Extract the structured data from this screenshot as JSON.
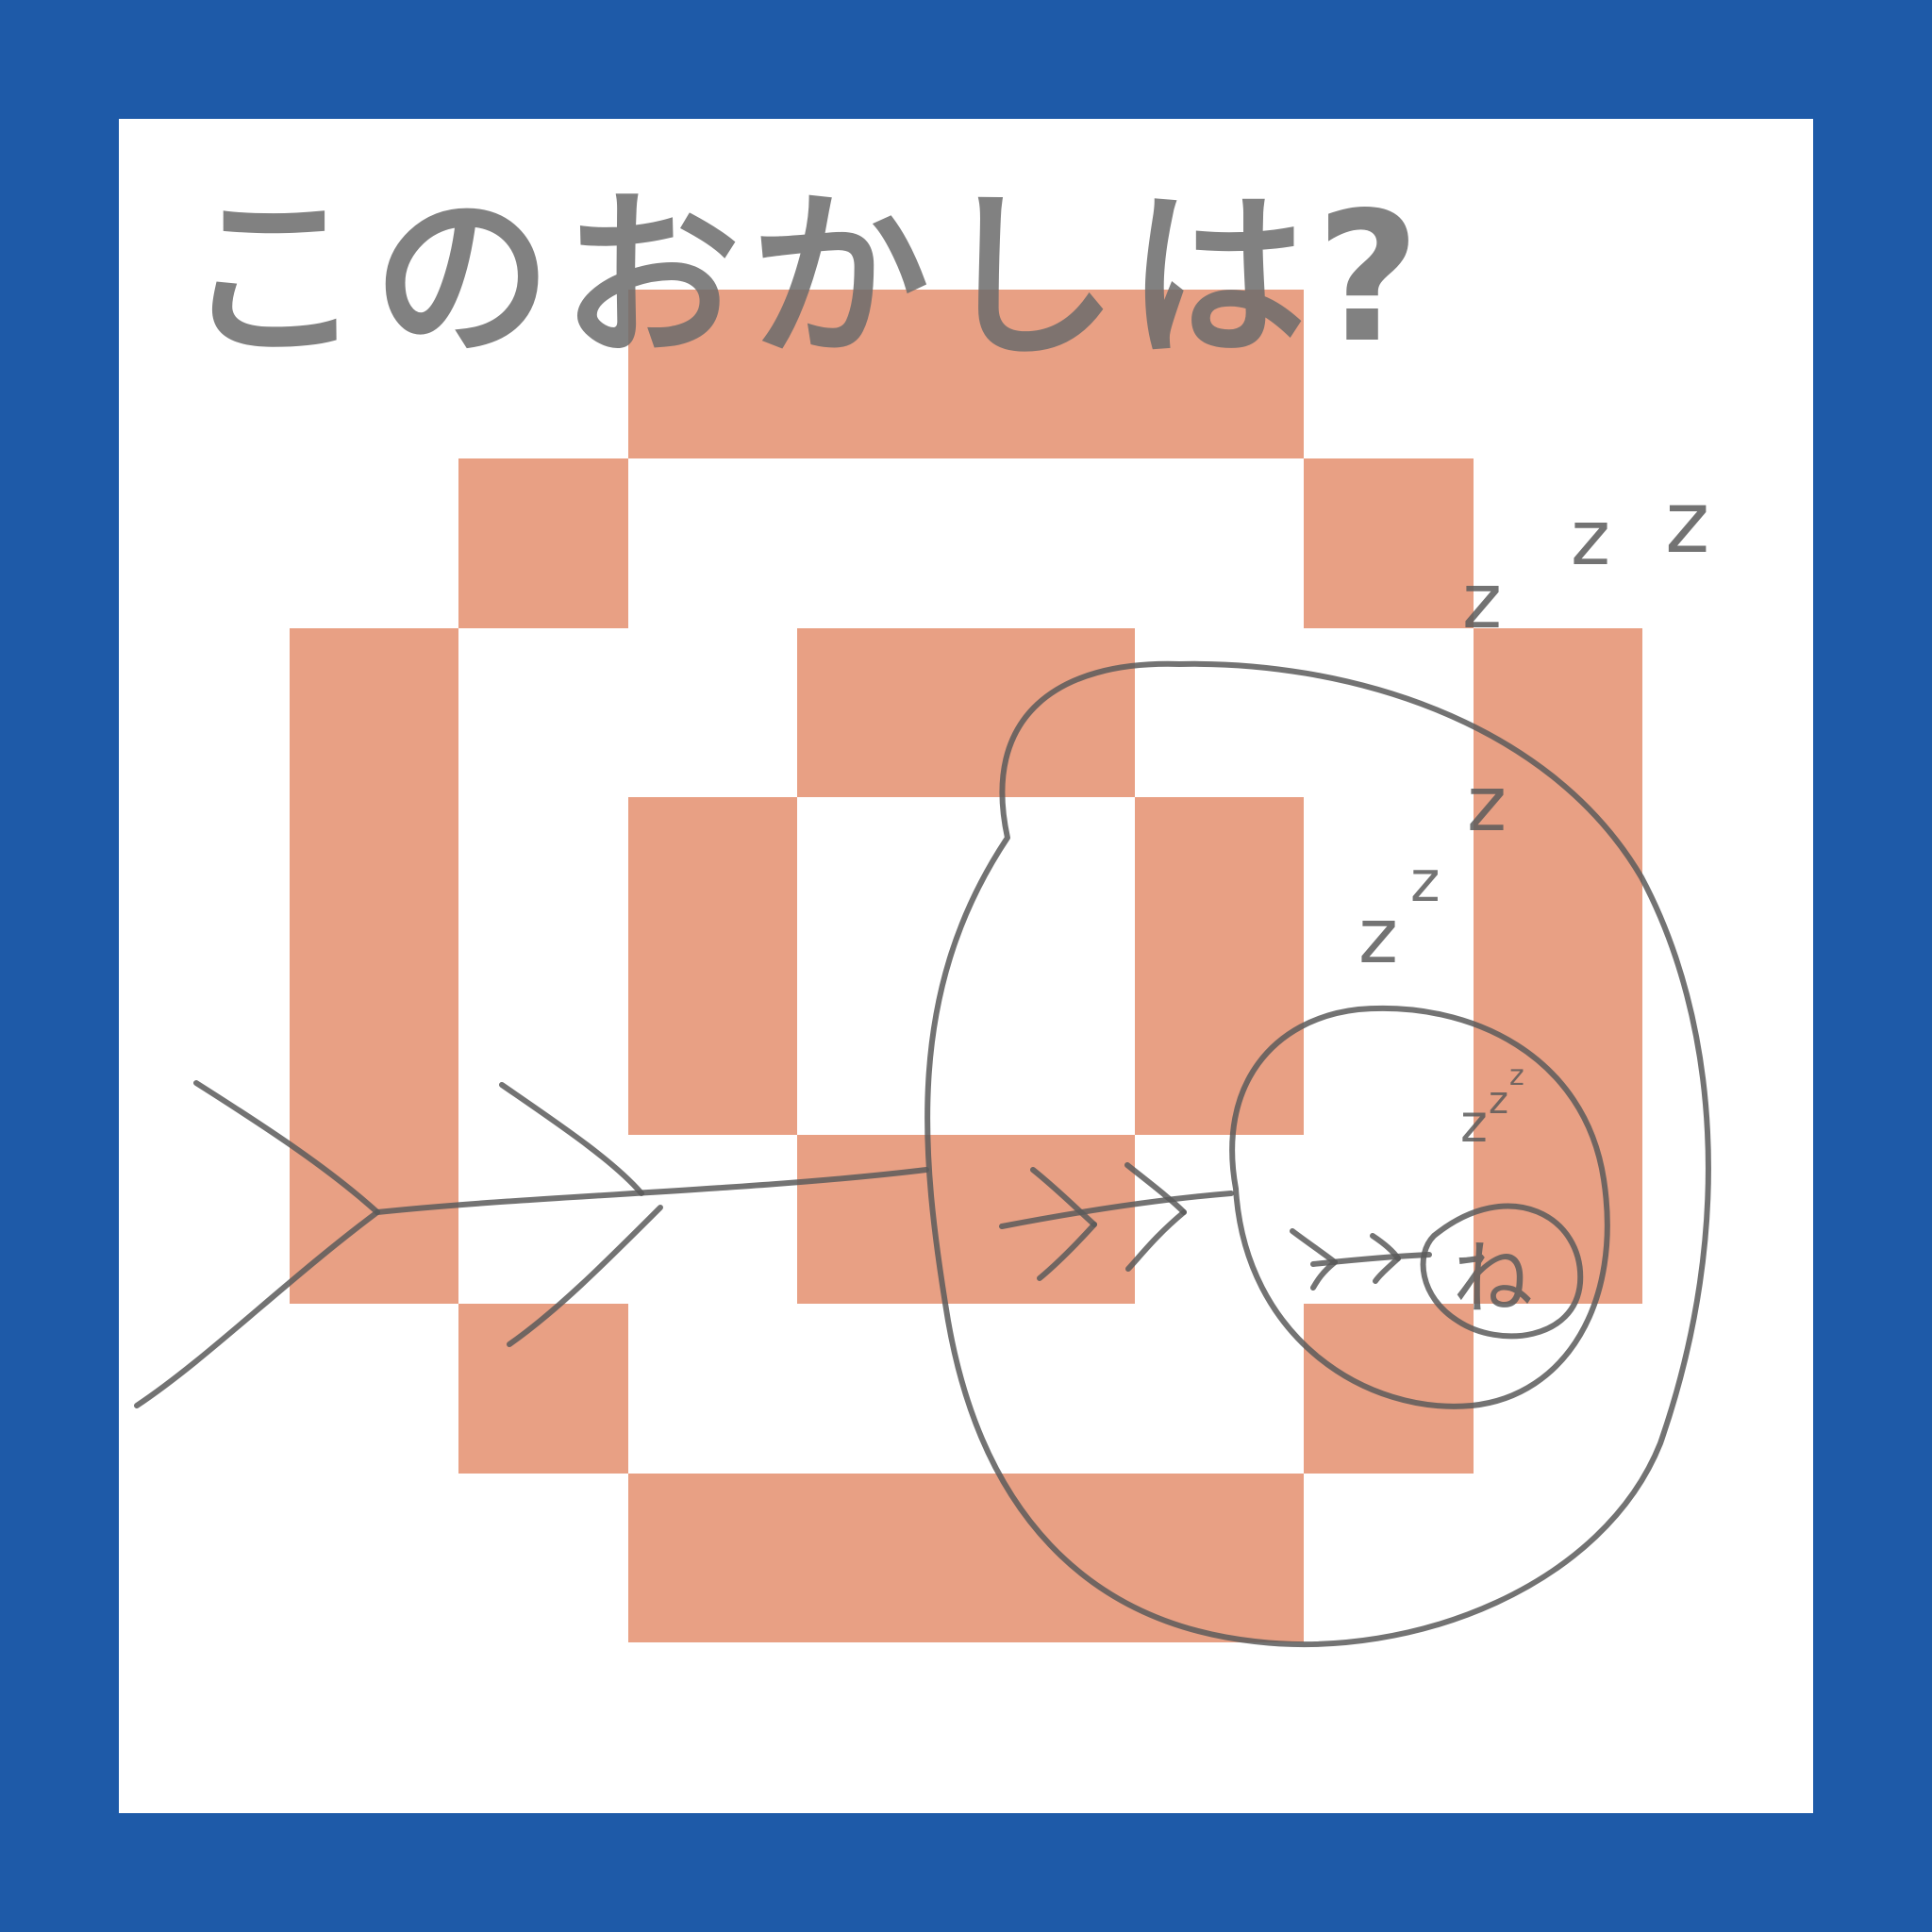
{
  "title": {
    "text": "このおかしは?"
  },
  "sleep_marks": {
    "z1": "z",
    "z2": "z",
    "z3": "z",
    "z4": "z",
    "z5": "z",
    "z6": "z",
    "z7": "z",
    "z8": "z",
    "z9": "z"
  },
  "center_label": {
    "text": "ね"
  },
  "colors": {
    "frame_border": "#1e5aa8",
    "panel_background": "#ffffff",
    "pixel_fill": "#e8a084",
    "sketch_stroke": "#5a5a5a"
  }
}
